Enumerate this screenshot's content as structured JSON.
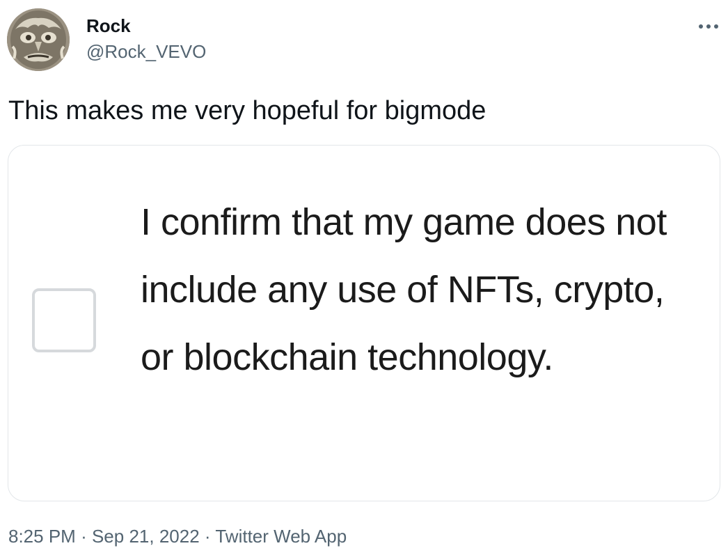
{
  "author": {
    "display_name": "Rock",
    "handle": "@Rock_VEVO",
    "avatar_icon": "avatar-icon"
  },
  "more_icon": "more-icon",
  "tweet": {
    "text": "This makes me very hopeful for bigmode"
  },
  "media": {
    "checkbox_checked": false,
    "confirm_text": "I confirm that my game does not include any use of NFTs, crypto, or blockchain technology."
  },
  "meta": {
    "time": "8:25 PM",
    "separator": "·",
    "date": "Sep 21, 2022",
    "source": "Twitter Web App"
  },
  "colors": {
    "text_primary": "#0f1419",
    "text_secondary": "#536471",
    "card_border": "#e2e6e9",
    "checkbox_border": "#d6d9dc"
  }
}
